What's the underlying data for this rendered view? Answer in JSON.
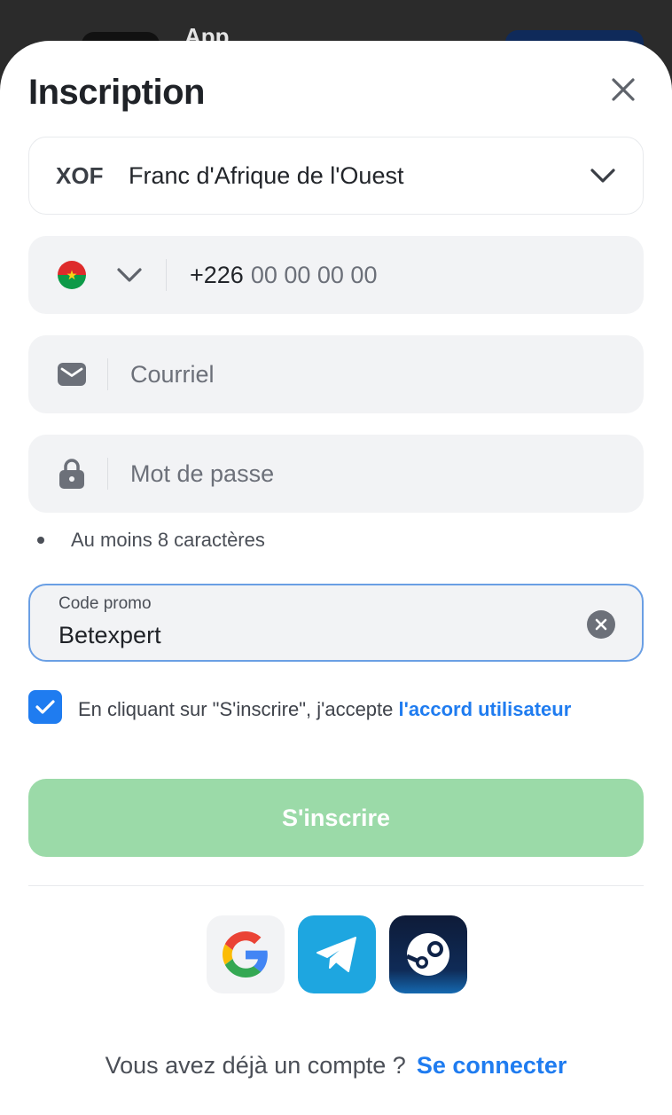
{
  "background": {
    "app_title": "App"
  },
  "form": {
    "title": "Inscription",
    "currency": {
      "code": "XOF",
      "name": "Franc d'Afrique de l'Ouest"
    },
    "phone": {
      "country_code": "+226",
      "placeholder": "00 00 00 00"
    },
    "email": {
      "placeholder": "Courriel"
    },
    "password": {
      "placeholder": "Mot de passe",
      "hint": "Au moins 8 caractères"
    },
    "promo": {
      "label": "Code promo",
      "value": "Betexpert"
    },
    "agreement": {
      "text": "En cliquant sur \"S'inscrire\", j'accepte ",
      "link": "l'accord utilisateur",
      "checked": true
    },
    "submit_label": "S'inscrire",
    "login": {
      "text": "Vous avez déjà un compte ?",
      "link": "Se connecter"
    }
  },
  "icons": [
    "close-icon",
    "chevron-down-icon",
    "burkina-faso-flag-icon",
    "mail-icon",
    "lock-icon",
    "clear-icon",
    "check-icon",
    "google-icon",
    "telegram-icon",
    "steam-icon"
  ],
  "colors": {
    "accent": "#1f7cf0",
    "submit_disabled": "#9bdaa8",
    "field_bg": "#f2f3f5",
    "focus_border": "#6a9fe4"
  }
}
